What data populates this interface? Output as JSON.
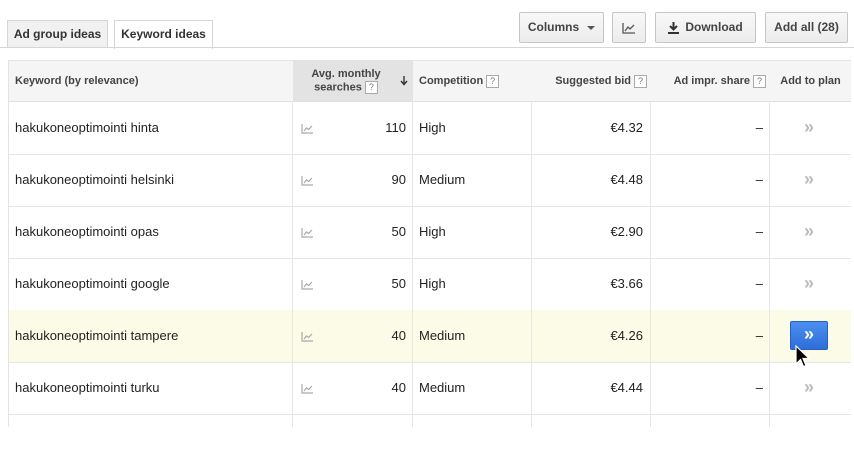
{
  "tabs": [
    {
      "label": "Ad group ideas"
    },
    {
      "label": "Keyword ideas",
      "active": true
    }
  ],
  "toolbar": {
    "columns_label": "Columns",
    "download_label": "Download",
    "add_all_label": "Add all (28)"
  },
  "table": {
    "headers": {
      "keyword": "Keyword (by relevance)",
      "searches_line1": "Avg. monthly",
      "searches_line2": "searches",
      "competition": "Competition",
      "bid": "Suggested bid",
      "impr": "Ad impr. share",
      "add": "Add to plan"
    },
    "help_glyph": "?",
    "add_glyph": "»",
    "rows": [
      {
        "keyword": "hakukoneoptimointi hinta",
        "searches": "110",
        "competition": "High",
        "bid": "€4.32",
        "impr": "–"
      },
      {
        "keyword": "hakukoneoptimointi helsinki",
        "searches": "90",
        "competition": "Medium",
        "bid": "€4.48",
        "impr": "–"
      },
      {
        "keyword": "hakukoneoptimointi opas",
        "searches": "50",
        "competition": "High",
        "bid": "€2.90",
        "impr": "–"
      },
      {
        "keyword": "hakukoneoptimointi google",
        "searches": "50",
        "competition": "High",
        "bid": "€3.66",
        "impr": "–"
      },
      {
        "keyword": "hakukoneoptimointi tampere",
        "searches": "40",
        "competition": "Medium",
        "bid": "€4.26",
        "impr": "–",
        "highlighted": true
      },
      {
        "keyword": "hakukoneoptimointi turku",
        "searches": "40",
        "competition": "Medium",
        "bid": "€4.44",
        "impr": "–"
      }
    ]
  },
  "icons": {
    "chart": "line-chart-icon",
    "download": "download-icon",
    "sort": "sort-desc-icon",
    "cursor": "mouse-pointer-icon"
  }
}
